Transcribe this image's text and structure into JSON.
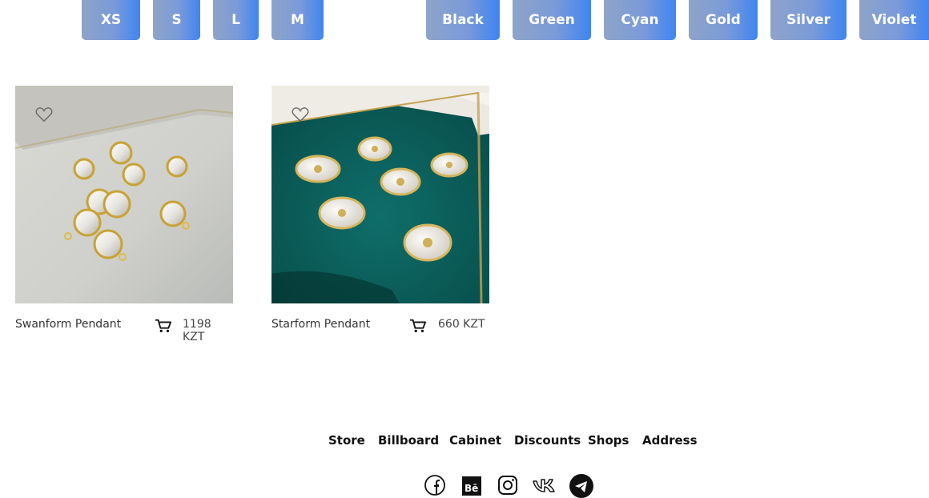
{
  "size_filters": [
    "XS",
    "S",
    "L",
    "M"
  ],
  "color_filters": [
    "Black",
    "Green",
    "Cyan",
    "Gold",
    "Silver",
    "Violet"
  ],
  "products": [
    {
      "name": "Swanform Pendant",
      "price": "1198 KZT"
    },
    {
      "name": "Starform Pendant",
      "price": "660 KZT"
    }
  ],
  "footer": {
    "links": [
      "Store",
      "Billboard",
      "Cabinet",
      "Discounts",
      "Shops",
      "Address"
    ],
    "social": [
      "facebook-icon",
      "behance-icon",
      "instagram-icon",
      "vk-icon",
      "telegram-icon"
    ]
  },
  "colors": {
    "chip_gradient_start": "#8ea4c8",
    "chip_gradient_end": "#3f85f0",
    "teal_velvet": "#0b5d5a"
  }
}
